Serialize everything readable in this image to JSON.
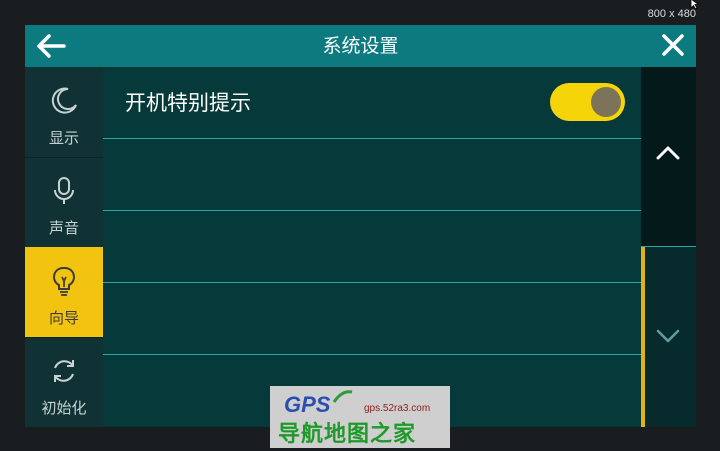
{
  "resolution_label": "800 x 480",
  "header": {
    "title": "系统设置"
  },
  "sidebar": {
    "items": [
      {
        "label": "显示",
        "icon": "moon-icon",
        "active": false
      },
      {
        "label": "声音",
        "icon": "microphone-icon",
        "active": false
      },
      {
        "label": "向导",
        "icon": "lightbulb-icon",
        "active": true
      },
      {
        "label": "初始化",
        "icon": "refresh-icon",
        "active": false
      }
    ]
  },
  "settings": {
    "rows": [
      {
        "label": "开机特别提示",
        "toggle": true
      },
      {
        "label": ""
      },
      {
        "label": ""
      },
      {
        "label": ""
      }
    ]
  },
  "watermark": {
    "brand": "GPS",
    "url": "gps.52ra3.com",
    "text": "导航地图之家"
  },
  "colors": {
    "header": "#0d7a80",
    "accent": "#f2c40f",
    "content_bg": "#063a3a"
  }
}
